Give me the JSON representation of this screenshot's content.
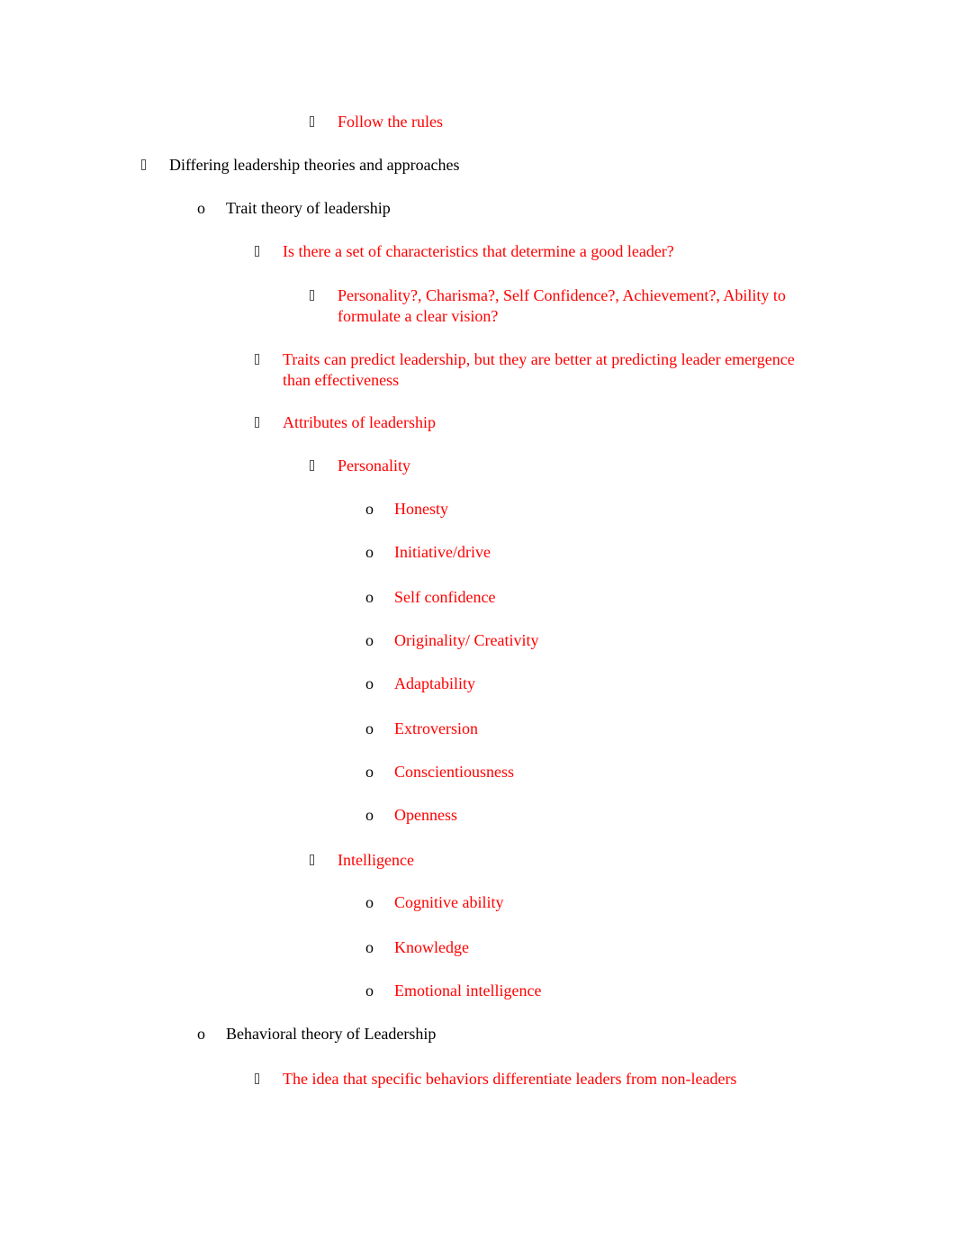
{
  "document": {
    "colors": {
      "body_text": "#000000",
      "highlight_text": "#ff0000"
    },
    "items": [
      {
        "level": 3,
        "bullet": "box-icon",
        "color": "red",
        "text": "Follow the rules"
      },
      {
        "level": 0,
        "bullet": "box-icon",
        "color": "black",
        "text": "Differing leadership theories and approaches"
      },
      {
        "level": 1,
        "bullet": "o",
        "color": "black",
        "text": "Trait theory of leadership"
      },
      {
        "level": 2,
        "bullet": "box-icon",
        "color": "red",
        "text": "Is there a set of characteristics that determine a good leader?"
      },
      {
        "level": 3,
        "bullet": "box-icon",
        "color": "red",
        "text_line1": "Personality?, Charisma?, Self Confidence?, Achievement?, Ability to",
        "text_line2": "formulate a clear vision?"
      },
      {
        "level": 2,
        "bullet": "box-icon",
        "color": "red",
        "text_line1": "Traits can predict leadership, but they are better at predicting leader emergence",
        "text_line2": "than effectiveness"
      },
      {
        "level": 2,
        "bullet": "box-icon",
        "color": "red",
        "text": "Attributes of leadership"
      },
      {
        "level": 3,
        "bullet": "box-icon",
        "color": "red",
        "text": "Personality"
      },
      {
        "level": 4,
        "bullet": "o",
        "color": "red",
        "text": "Honesty"
      },
      {
        "level": 4,
        "bullet": "o",
        "color": "red",
        "text": "Initiative/drive"
      },
      {
        "level": 4,
        "bullet": "o",
        "color": "red",
        "text": "Self confidence"
      },
      {
        "level": 4,
        "bullet": "o",
        "color": "red",
        "text": "Originality/ Creativity"
      },
      {
        "level": 4,
        "bullet": "o",
        "color": "red",
        "text": "Adaptability"
      },
      {
        "level": 4,
        "bullet": "o",
        "color": "red",
        "text": "Extroversion"
      },
      {
        "level": 4,
        "bullet": "o",
        "color": "red",
        "text": "Conscientiousness"
      },
      {
        "level": 4,
        "bullet": "o",
        "color": "red",
        "text": "Openness"
      },
      {
        "level": 3,
        "bullet": "box-icon",
        "color": "red",
        "text": "Intelligence"
      },
      {
        "level": 4,
        "bullet": "o",
        "color": "red",
        "text": "Cognitive ability"
      },
      {
        "level": 4,
        "bullet": "o",
        "color": "red",
        "text": "Knowledge"
      },
      {
        "level": 4,
        "bullet": "o",
        "color": "red",
        "text": "Emotional intelligence"
      },
      {
        "level": 1,
        "bullet": "o",
        "color": "black",
        "text": "Behavioral theory of Leadership"
      },
      {
        "level": 2,
        "bullet": "box-icon",
        "color": "red",
        "text": "The idea that specific behaviors differentiate leaders from non-leaders"
      }
    ],
    "circle_bullet_glyph": "o"
  }
}
